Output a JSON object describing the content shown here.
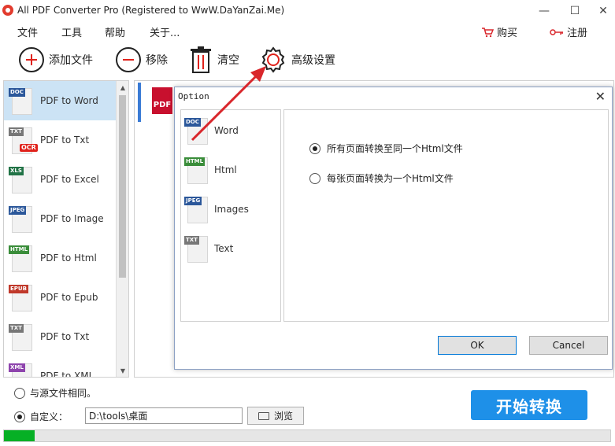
{
  "window": {
    "title": "All PDF Converter Pro (Registered to WwW.DaYanZai.Me)",
    "minimize": "—",
    "maximize": "☐",
    "close": "✕"
  },
  "menu": {
    "items": [
      "文件",
      "工具",
      "帮助",
      "关于..."
    ],
    "buy_label": "购买",
    "register_label": "注册"
  },
  "toolbar": {
    "add_label": "添加文件",
    "remove_label": "移除",
    "clear_label": "清空",
    "settings_label": "高级设置"
  },
  "sidebar": {
    "items": [
      {
        "label": "PDF to Word",
        "tag": "DOC",
        "tag_color": "#2b579a"
      },
      {
        "label": "PDF to Txt",
        "tag": "TXT",
        "tag_color": "#777777",
        "badge": "OCR"
      },
      {
        "label": "PDF to Excel",
        "tag": "XLS",
        "tag_color": "#217346"
      },
      {
        "label": "PDF to Image",
        "tag": "JPEG",
        "tag_color": "#2b579a"
      },
      {
        "label": "PDF to Html",
        "tag": "HTML",
        "tag_color": "#3a8d3a"
      },
      {
        "label": "PDF to Epub",
        "tag": "EPUB",
        "tag_color": "#c0392b"
      },
      {
        "label": "PDF to Txt",
        "tag": "TXT",
        "tag_color": "#777777"
      },
      {
        "label": "PDF to XML",
        "tag": "XML",
        "tag_color": "#8e44ad"
      }
    ],
    "selected_index": 0
  },
  "file_panel": {
    "file_icon_label": "PDF"
  },
  "dialog": {
    "title": "Option",
    "close": "✕",
    "options": [
      {
        "label": "Word",
        "tag": "DOC",
        "tag_color": "#2b579a"
      },
      {
        "label": "Html",
        "tag": "HTML",
        "tag_color": "#3a8d3a"
      },
      {
        "label": "Images",
        "tag": "JPEG",
        "tag_color": "#2b579a"
      },
      {
        "label": "Text",
        "tag": "TXT",
        "tag_color": "#777777"
      }
    ],
    "radios": [
      {
        "label": "所有页面转换至同一个Html文件",
        "checked": true
      },
      {
        "label": "每张页面转换为一个Html文件",
        "checked": false
      }
    ],
    "ok_label": "OK",
    "cancel_label": "Cancel"
  },
  "output": {
    "same_as_source_label": "与源文件相同。",
    "custom_label": "自定义：",
    "path_value": "D:\\tools\\桌面",
    "browse_label": "浏览",
    "start_label": "开始转换",
    "progress_percent": 5,
    "selected_option": "custom"
  },
  "colors": {
    "accent": "#1e90e8",
    "progress": "#06b025",
    "arrow": "#d9262b"
  }
}
